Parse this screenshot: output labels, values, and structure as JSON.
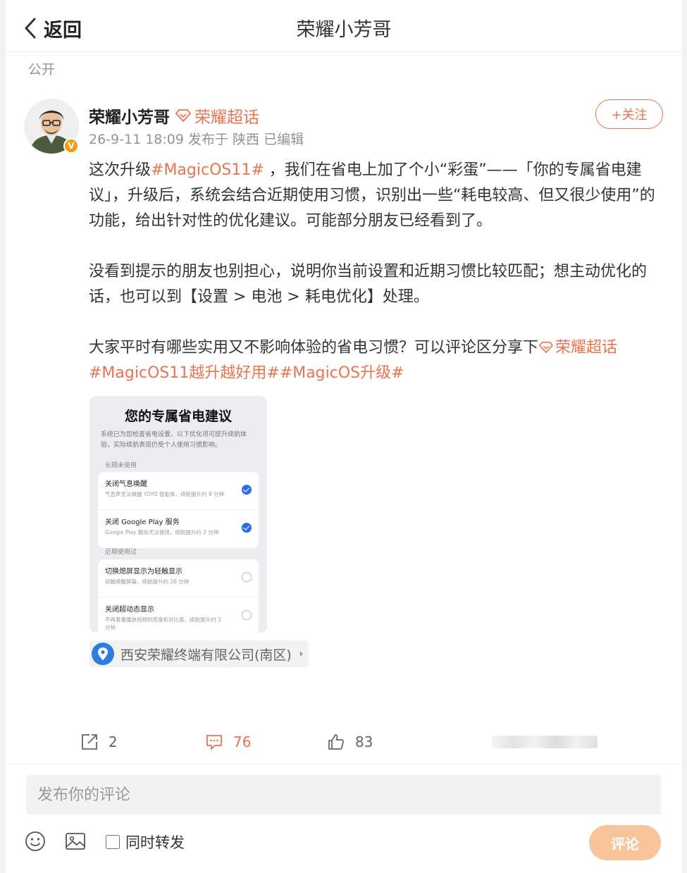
{
  "header": {
    "back_label": "返回",
    "title": "荣耀小芳哥"
  },
  "post": {
    "visibility": "公开",
    "author": {
      "name": "荣耀小芳哥",
      "badge": "V",
      "super_topic": "荣耀超话",
      "follow_label": "+关注"
    },
    "meta": {
      "time": "26-9-11 18:09",
      "source": "发布于 陕西",
      "edited": "已编辑"
    },
    "paragraphs": {
      "p1": {
        "pre": "这次升级",
        "tag": "#MagicOS11#",
        "post": " ，我们在省电上加了个小“彩蛋”——「你的专属省电建议」，升级后，系统会结合近期使用习惯，识别出一些“耗电较高、但又很少使用”的功能，给出针对性的优化建议。可能部分朋友已经看到了。"
      },
      "p2": "没看到提示的朋友也别担心，说明你当前设置和近期习惯比较匹配；想主动优化的话，也可以到【设置 > 电池 > 耗电优化】处理。",
      "p3": {
        "text": "大家平时有哪些实用又不影响体验的省电习惯？可以评论区分享下",
        "topic": "荣耀超话",
        "tag1": "#MagicOS11越升越好用#",
        "tag2": "#MagicOS升级#"
      }
    },
    "image": {
      "title": "您的专属省电建议",
      "desc": "系统已为您检查省电设置，以下优化项可提升续航体验，实际续航表现仍受个人使用习惯影响。",
      "sections": [
        {
          "label": "长期未使用",
          "items": [
            {
              "title": "关闭气息唤醒",
              "sub": "气息声无法唤醒 YOYO 智能体，续航提升约 9 分钟",
              "checked": true
            },
            {
              "title": "关闭 Google Play 服务",
              "sub": "Google Play 服务无法使用，续航提升约 2 分钟",
              "checked": true
            }
          ]
        },
        {
          "label": "近期使用过",
          "items": [
            {
              "title": "切换熄屏显示为轻触显示",
              "sub": "轻触唤醒屏幕，续航提升约 26 分钟",
              "checked": false
            },
            {
              "title": "关闭超动态显示",
              "sub": "不再着重播放视频的亮度和对比度，续航提升约 3 分钟",
              "checked": false
            }
          ]
        }
      ]
    },
    "location": "西安荣耀终端有限公司(南区)",
    "stats": {
      "reposts": "2",
      "comments": "76",
      "likes": "83"
    }
  },
  "composer": {
    "placeholder": "发布你的评论",
    "repost_label": "同时转发",
    "submit_label": "评论"
  },
  "colors": {
    "accent": "#eb7350",
    "submit_bg": "#f8c49a",
    "location_pin": "#2d7ee3",
    "check_blue": "#2b6de5"
  }
}
